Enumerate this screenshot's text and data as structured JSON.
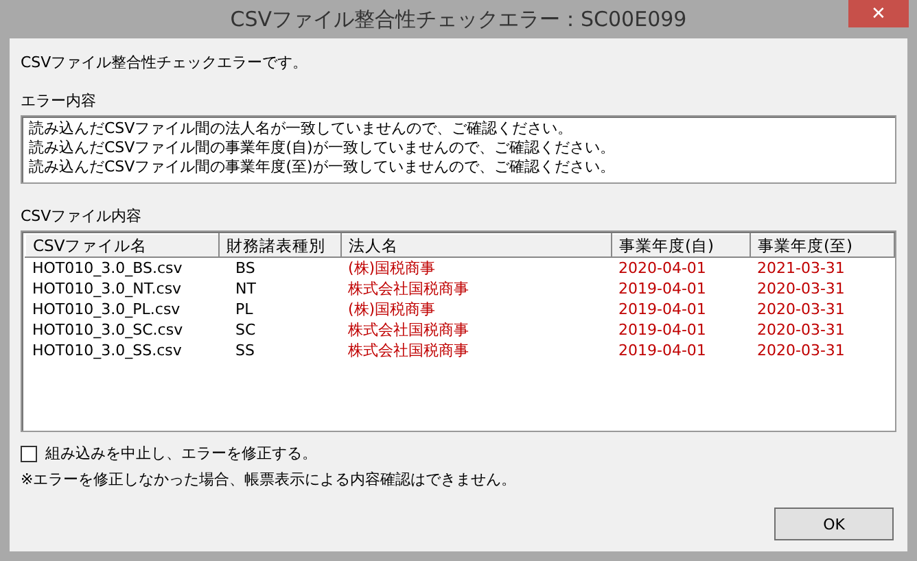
{
  "window": {
    "title": "CSVファイル整合性チェックエラー：SC00E099",
    "close": "✕"
  },
  "message": "CSVファイル整合性チェックエラーです。",
  "error_section": {
    "label": "エラー内容",
    "lines": [
      "読み込んだCSVファイル間の法人名が一致していませんので、ご確認ください。",
      "読み込んだCSVファイル間の事業年度(自)が一致していませんので、ご確認ください。",
      "読み込んだCSVファイル間の事業年度(至)が一致していませんので、ご確認ください。"
    ]
  },
  "table": {
    "label": "CSVファイル内容",
    "columns": [
      "CSVファイル名",
      "財務諸表種別",
      "法人名",
      "事業年度(自)",
      "事業年度(至)"
    ],
    "rows": [
      {
        "cells": [
          {
            "text": "HOT010_3.0_BS.csv",
            "error": false
          },
          {
            "text": "BS",
            "error": false
          },
          {
            "text": "(株)国税商事",
            "error": true
          },
          {
            "text": "2020-04-01",
            "error": true
          },
          {
            "text": "2021-03-31",
            "error": true
          }
        ]
      },
      {
        "cells": [
          {
            "text": "HOT010_3.0_NT.csv",
            "error": false
          },
          {
            "text": "NT",
            "error": false
          },
          {
            "text": "株式会社国税商事",
            "error": true
          },
          {
            "text": "2019-04-01",
            "error": true
          },
          {
            "text": "2020-03-31",
            "error": true
          }
        ]
      },
      {
        "cells": [
          {
            "text": "HOT010_3.0_PL.csv",
            "error": false
          },
          {
            "text": "PL",
            "error": false
          },
          {
            "text": "(株)国税商事",
            "error": true
          },
          {
            "text": "2019-04-01",
            "error": true
          },
          {
            "text": "2020-03-31",
            "error": true
          }
        ]
      },
      {
        "cells": [
          {
            "text": "HOT010_3.0_SC.csv",
            "error": false
          },
          {
            "text": "SC",
            "error": false
          },
          {
            "text": "株式会社国税商事",
            "error": true
          },
          {
            "text": "2019-04-01",
            "error": true
          },
          {
            "text": "2020-03-31",
            "error": true
          }
        ]
      },
      {
        "cells": [
          {
            "text": "HOT010_3.0_SS.csv",
            "error": false
          },
          {
            "text": "SS",
            "error": false
          },
          {
            "text": "株式会社国税商事",
            "error": true
          },
          {
            "text": "2019-04-01",
            "error": true
          },
          {
            "text": "2020-03-31",
            "error": true
          }
        ]
      }
    ]
  },
  "abort_option": {
    "label": "組み込みを中止し、エラーを修正する。",
    "checked": false
  },
  "note": "※エラーを修正しなかった場合、帳票表示による内容確認はできません。",
  "buttons": [
    "OK"
  ]
}
